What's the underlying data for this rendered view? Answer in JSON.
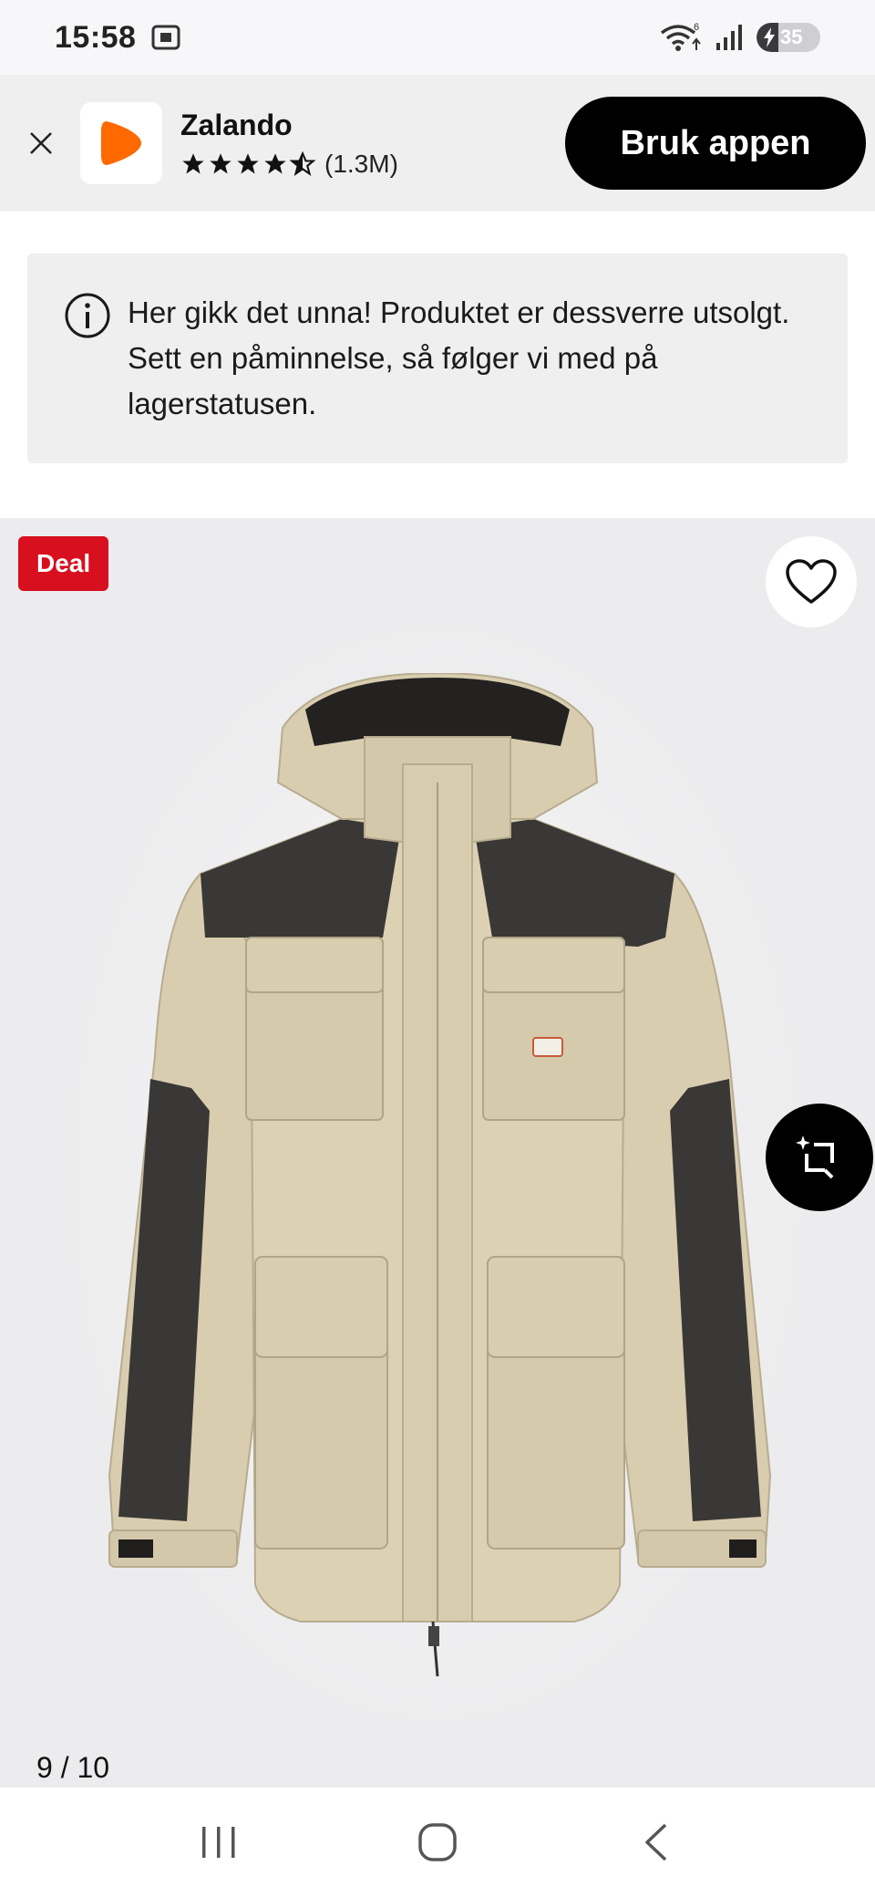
{
  "status_bar": {
    "time": "15:58",
    "wifi_badge": "6",
    "battery_level": "35",
    "icons": [
      "screenshot-icon",
      "wifi-icon",
      "signal-icon",
      "battery-charging-icon"
    ]
  },
  "app_banner": {
    "app_name": "Zalando",
    "rating_stars": 4.5,
    "rating_count": "(1.3M)",
    "cta_label": "Bruk appen",
    "brand_color": "#ff6900"
  },
  "notice": {
    "text": "Her gikk det unna! Produktet er dessverre utsolgt. Sett en påminnelse, så følger vi med på lagerstatusen."
  },
  "product": {
    "badge": "Deal",
    "badge_color": "#d70f1f",
    "image_counter": "9 / 10",
    "image_subject": "beige parka jacket with black shoulder and sleeve panels"
  },
  "nav": {
    "items": [
      "recent-apps-icon",
      "home-icon",
      "back-icon"
    ]
  }
}
